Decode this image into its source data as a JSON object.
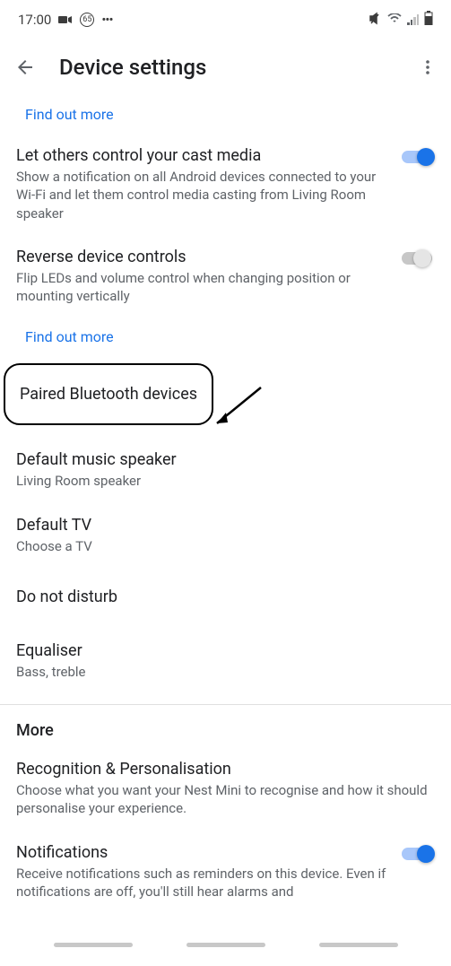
{
  "status": {
    "time": "17:00",
    "dots": "•••"
  },
  "header": {
    "title": "Device settings"
  },
  "links": {
    "find_out_more": "Find out more"
  },
  "settings": {
    "cast": {
      "title": "Let others control your cast media",
      "desc": "Show a notification on all Android devices connected to your Wi-Fi and let them control media casting from Living Room speaker"
    },
    "reverse": {
      "title": "Reverse device controls",
      "desc": "Flip LEDs and volume control when changing position or mounting vertically"
    },
    "paired": {
      "title": "Paired Bluetooth devices"
    },
    "default_speaker": {
      "title": "Default music speaker",
      "desc": "Living Room speaker"
    },
    "default_tv": {
      "title": "Default TV",
      "desc": "Choose a TV"
    },
    "dnd": {
      "title": "Do not disturb"
    },
    "equaliser": {
      "title": "Equaliser",
      "desc": "Bass, treble"
    }
  },
  "more": {
    "header": "More",
    "recognition": {
      "title": "Recognition & Personalisation",
      "desc": "Choose what you want your Nest Mini to recognise and how it should personalise your experience."
    },
    "notifications": {
      "title": "Notifications",
      "desc": "Receive notifications such as reminders on this device. Even if notifications are off, you'll still hear alarms and"
    }
  }
}
